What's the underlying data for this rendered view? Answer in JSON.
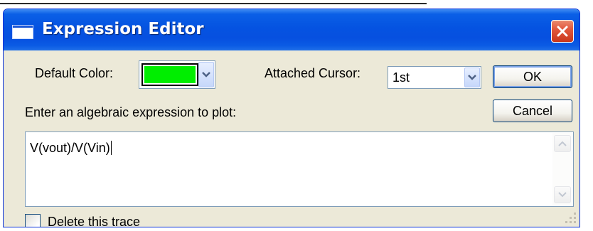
{
  "window": {
    "title": "Expression Editor"
  },
  "default_color": {
    "label": "Default Color:",
    "selected_color": "#00ee00"
  },
  "attached_cursor": {
    "label": "Attached Cursor:",
    "value": "1st"
  },
  "buttons": {
    "ok": "OK",
    "cancel": "Cancel"
  },
  "expression": {
    "prompt": "Enter an algebraic expression to plot:",
    "value": "V(vout)/V(Vin)"
  },
  "delete_trace": {
    "label": "Delete this trace",
    "checked": false
  },
  "icons": {
    "window": "window-icon",
    "close": "close-icon",
    "dropdown": "chevron-down-icon",
    "scroll_up": "scroll-up-icon",
    "scroll_down": "scroll-down-icon",
    "resize": "resize-grip-icon"
  },
  "colors": {
    "titlebar": "#0553e1",
    "dialog_bg": "#ece9d8",
    "close_button": "#e2583d",
    "input_border": "#7f9db9"
  }
}
